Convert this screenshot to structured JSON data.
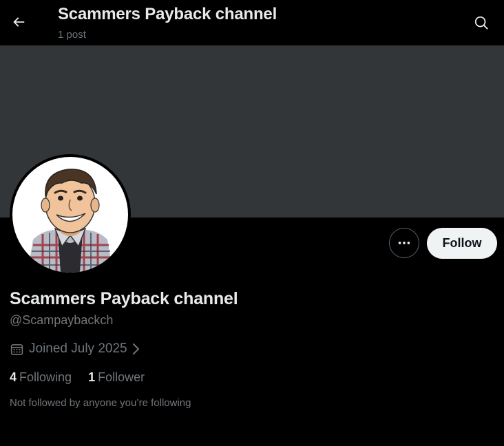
{
  "header": {
    "title": "Scammers Payback channel",
    "post_count": "1 post",
    "back_icon": "arrow-left-icon",
    "search_icon": "search-icon"
  },
  "profile": {
    "display_name": "Scammers Payback channel",
    "handle": "@Scampaybackch",
    "joined": "Joined July 2025",
    "following_count": "4",
    "following_label": "Following",
    "followers_count": "1",
    "followers_label": "Follower",
    "mutuals_note": "Not followed by anyone you’re following"
  },
  "actions": {
    "more_icon": "more-horizontal-icon",
    "follow_label": "Follow"
  },
  "colors": {
    "background": "#000000",
    "banner": "#333639",
    "primary_text": "#e7e9ea",
    "secondary_text": "#71767b",
    "follow_button_bg": "#eff3f4",
    "follow_button_text": "#0f1419"
  }
}
